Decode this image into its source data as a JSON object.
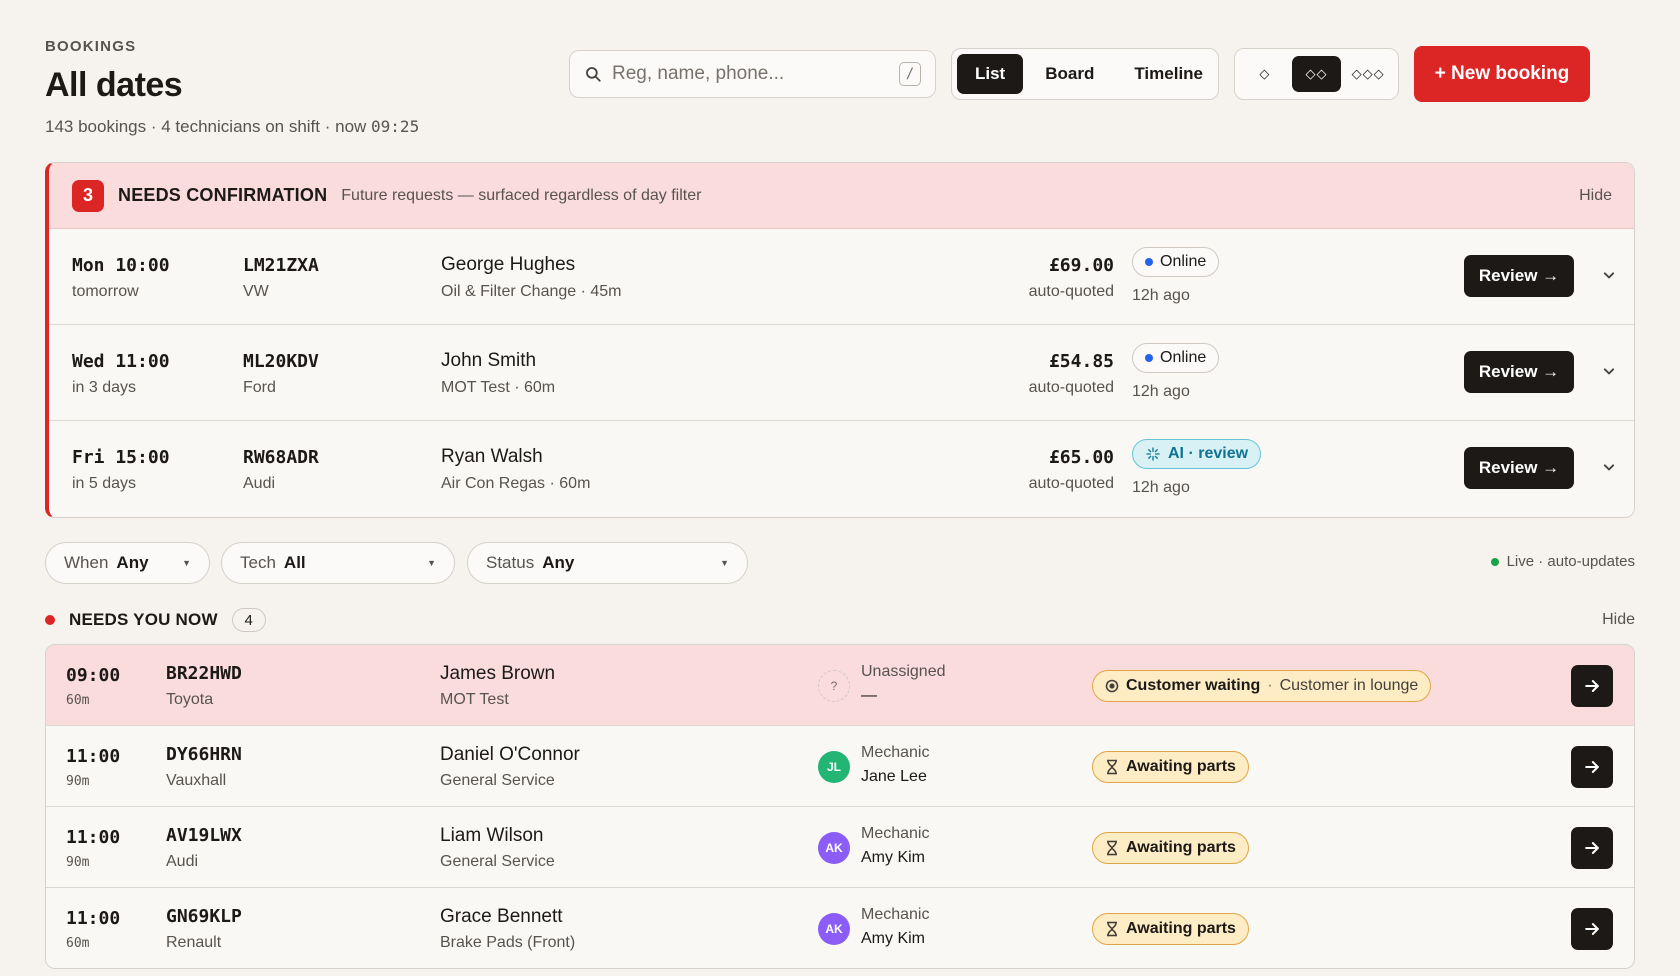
{
  "header": {
    "eyebrow": "BOOKINGS",
    "title": "All dates",
    "subtitle_counts": "143 bookings · 4 technicians on shift · now ",
    "now_time": "09:25"
  },
  "search": {
    "placeholder": "Reg, name, phone...",
    "shortcut": "/"
  },
  "views": [
    {
      "label": "List",
      "active": true
    },
    {
      "label": "Board",
      "active": false
    },
    {
      "label": "Timeline",
      "active": false
    }
  ],
  "density": [
    {
      "glyph": "◇",
      "active": false
    },
    {
      "glyph": "◇◇",
      "active": true
    },
    {
      "glyph": "◇◇◇",
      "active": false
    }
  ],
  "new_booking_label": "+ New booking",
  "confirmation": {
    "count": "3",
    "title": "NEEDS CONFIRMATION",
    "note": "Future requests — surfaced regardless of day filter",
    "hide_label": "Hide",
    "rows": [
      {
        "when": "Mon 10:00",
        "relative": "tomorrow",
        "reg": "LM21ZXA",
        "make": "VW",
        "name": "George Hughes",
        "service": "Oil & Filter Change · 45m",
        "price": "£69.00",
        "quote": "auto-quoted",
        "source": "Online",
        "source_type": "online",
        "ago": "12h ago",
        "action": "Review →"
      },
      {
        "when": "Wed 11:00",
        "relative": "in 3 days",
        "reg": "ML20KDV",
        "make": "Ford",
        "name": "John Smith",
        "service": "MOT Test · 60m",
        "price": "£54.85",
        "quote": "auto-quoted",
        "source": "Online",
        "source_type": "online",
        "ago": "12h ago",
        "action": "Review →"
      },
      {
        "when": "Fri 15:00",
        "relative": "in 5 days",
        "reg": "RW68ADR",
        "make": "Audi",
        "name": "Ryan Walsh",
        "service": "Air Con Regas · 60m",
        "price": "£65.00",
        "quote": "auto-quoted",
        "source": "AI · review",
        "source_type": "ai",
        "ago": "12h ago",
        "action": "Review →"
      }
    ]
  },
  "filters": [
    {
      "label": "When",
      "value": "Any"
    },
    {
      "label": "Tech",
      "value": "All"
    },
    {
      "label": "Status",
      "value": "Any"
    }
  ],
  "live_label": "Live · auto-updates",
  "needs_now": {
    "title": "NEEDS YOU NOW",
    "count": "4",
    "hide_label": "Hide",
    "rows": [
      {
        "time": "09:00",
        "duration": "60m",
        "reg": "BR22HWD",
        "make": "Toyota",
        "name": "James Brown",
        "service": "MOT Test",
        "avatar": "?",
        "avatar_color": "",
        "role": "Unassigned",
        "tech": "—",
        "status": "Customer waiting",
        "status_detail": "Customer in lounge",
        "status_type": "waiting"
      },
      {
        "time": "11:00",
        "duration": "90m",
        "reg": "DY66HRN",
        "make": "Vauxhall",
        "name": "Daniel O'Connor",
        "service": "General Service",
        "avatar": "JL",
        "avatar_color": "#22b573",
        "role": "Mechanic",
        "tech": "Jane Lee",
        "status": "Awaiting parts",
        "status_detail": "",
        "status_type": "parts"
      },
      {
        "time": "11:00",
        "duration": "90m",
        "reg": "AV19LWX",
        "make": "Audi",
        "name": "Liam Wilson",
        "service": "General Service",
        "avatar": "AK",
        "avatar_color": "#8b5cf6",
        "role": "Mechanic",
        "tech": "Amy Kim",
        "status": "Awaiting parts",
        "status_detail": "",
        "status_type": "parts"
      },
      {
        "time": "11:00",
        "duration": "60m",
        "reg": "GN69KLP",
        "make": "Renault",
        "name": "Grace Bennett",
        "service": "Brake Pads (Front)",
        "avatar": "AK",
        "avatar_color": "#8b5cf6",
        "role": "Mechanic",
        "tech": "Amy Kim",
        "status": "Awaiting parts",
        "status_detail": "",
        "status_type": "parts"
      }
    ]
  },
  "colors": {
    "accent_red": "#dc2626",
    "online_dot": "#2563eb",
    "ai_teal": "#0e7490",
    "live_dot": "#16a34a",
    "parts_amber": "#e0a548"
  }
}
